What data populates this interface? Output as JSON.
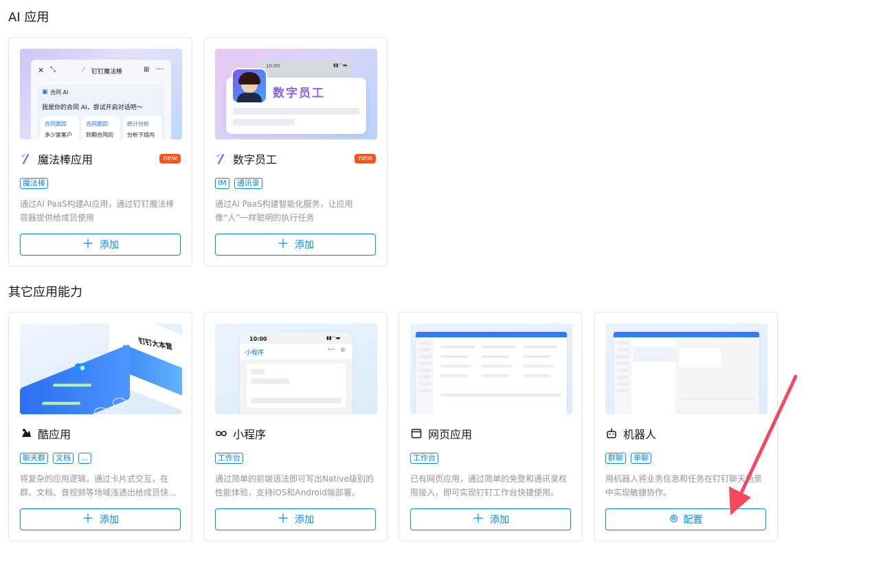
{
  "sections": {
    "ai": "AI 应用",
    "other": "其它应用能力"
  },
  "colors": {
    "primary": "#0089ff",
    "new_badge": "#ff5219",
    "arrow": "#f2495f"
  },
  "cards": [
    {
      "name": "魔法棒应用",
      "icon": "magic-wand-icon",
      "badge": "new",
      "tags": [
        "魔法棒"
      ],
      "desc": "通过AI PaaS构建AI应用，通过钉钉魔法棒容器提供给成员使用",
      "action": "添加",
      "preview": {
        "window_title": "钉钉魔法棒",
        "assistant": "合同 AI",
        "greeting": "我是你的合同 AI，尝试开启对话吧～",
        "chips": [
          "合同跟踪",
          "合同跟踪",
          "统计分析"
        ],
        "chip_texts": [
          "多少家客户",
          "到期合同的",
          "分析下组内"
        ]
      }
    },
    {
      "name": "数字员工",
      "icon": "magic-wand-icon",
      "badge": "new",
      "tags": [
        "IM",
        "通讯录"
      ],
      "desc": "通过AI PaaS构建智能化服务，让应用像“人”一样聪明的执行任务",
      "action": "添加",
      "preview": {
        "time": "10:00",
        "title": "数字员工"
      }
    },
    {
      "name": "酷应用",
      "icon": "cool-app-icon",
      "tags": [
        "聊天群",
        "文档",
        "..."
      ],
      "desc": "将复杂的应用逻辑，通过卡片式交互，在群、文档、音视频等场域浅透出给成员快...",
      "action": "添加",
      "preview": {
        "caption": "钉钉大本营"
      }
    },
    {
      "name": "小程序",
      "icon": "infinity-icon",
      "tags": [
        "工作台"
      ],
      "desc": "通过简单的前端语法即可写出Native级别的性能体验，支持iOS和Android端部署。",
      "action": "添加",
      "preview": {
        "time": "10:00",
        "title": "小程序"
      }
    },
    {
      "name": "网页应用",
      "icon": "browser-window-icon",
      "tags": [
        "工作台"
      ],
      "desc": "已有网页应用，通过简单的免登和通讯录权限接入，即可实现钉钉工作台快捷使用。",
      "action": "添加"
    },
    {
      "name": "机器人",
      "icon": "robot-icon",
      "tags": [
        "群聊",
        "单聊"
      ],
      "desc": "用机器人将业务信息和任务在钉钉聊天场景中实现敏捷协作。",
      "action": "配置"
    }
  ]
}
